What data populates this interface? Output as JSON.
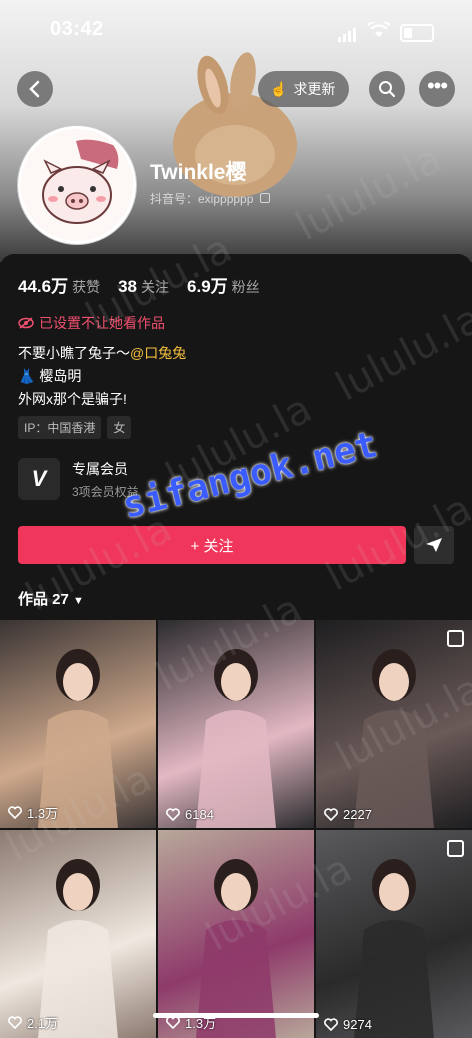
{
  "status_bar": {
    "time": "03:42"
  },
  "header": {
    "request_update_label": "求更新",
    "name": "Twinkle樱",
    "douyin_id": "抖音号：exipppppp"
  },
  "stats": [
    {
      "num": "44.6万",
      "label": "获赞"
    },
    {
      "num": "38",
      "label": "关注"
    },
    {
      "num": "6.9万",
      "label": "粉丝"
    }
  ],
  "blocked_notice": "已设置不让她看作品",
  "bio": {
    "line1_prefix": "不要小瞧了兔子～",
    "line1_mention": "@口兔兔",
    "line2": "樱岛明",
    "line3": "外网x那个是骗子!"
  },
  "tags": [
    "IP：中国香港",
    "女"
  ],
  "member": {
    "title": "专属会员",
    "subtitle": "3项会员权益"
  },
  "follow_label": "+ 关注",
  "works_label": "作品 27",
  "watermark_text": "lululu.la",
  "site_watermark": "sifangok.net",
  "grid": [
    {
      "likes": "1.3万",
      "multi": false,
      "c1": "#3a3434",
      "c2": "#cfa98c"
    },
    {
      "likes": "6184",
      "multi": false,
      "c1": "#2b2b2e",
      "c2": "#e3b8c3"
    },
    {
      "likes": "2227",
      "multi": true,
      "c1": "#1e1e20",
      "c2": "#6a5a58"
    },
    {
      "likes": "2.1万",
      "multi": false,
      "c1": "#8c7a70",
      "c2": "#f0e8e0"
    },
    {
      "likes": "1.3万",
      "multi": false,
      "c1": "#b8a89a",
      "c2": "#8e3a6a"
    },
    {
      "likes": "9274",
      "multi": true,
      "c1": "#5a5a5e",
      "c2": "#2a2a2a"
    }
  ]
}
